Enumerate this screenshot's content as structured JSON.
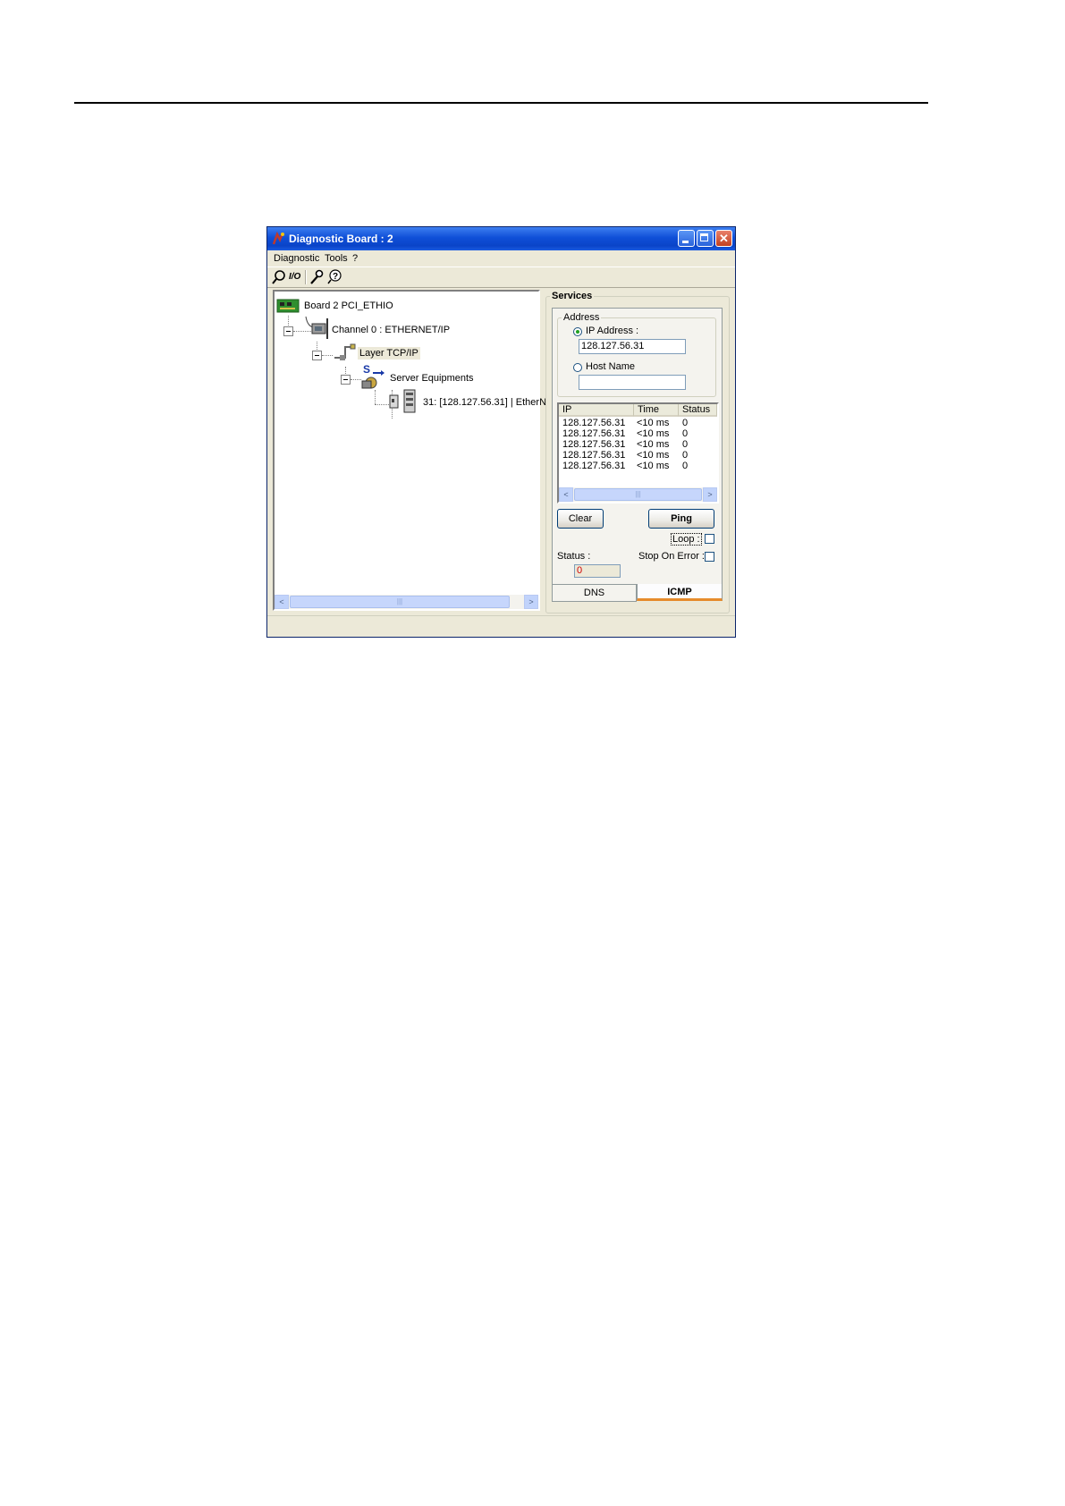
{
  "window": {
    "title": "Diagnostic Board : 2",
    "title_bar_color": "#0a44c8"
  },
  "menu": [
    "Diagnostic",
    "Tools",
    "?"
  ],
  "toolbar": {
    "io_label": "I/O",
    "icons": [
      "search-icon",
      "io-icon",
      "wrench-icon",
      "help-icon"
    ]
  },
  "tree": {
    "board": "Board 2 PCI_ETHIO",
    "channel": "Channel 0 : ETHERNET/IP",
    "layer": "Layer TCP/IP",
    "server": "Server  Equipments",
    "server_badge": "S",
    "equipment": "31: [128.127.56.31] | EtherN"
  },
  "services": {
    "group_label": "Services",
    "address_label": "Address",
    "ip_radio_label": "IP Address :",
    "ip_value": "128.127.56.31",
    "host_radio_label": "Host Name",
    "host_value": "",
    "ip_selected": true,
    "columns": [
      "IP",
      "Time",
      "Status"
    ],
    "rows": [
      {
        "ip": "128.127.56.31",
        "time": "<10 ms",
        "status": "0"
      },
      {
        "ip": "128.127.56.31",
        "time": "<10 ms",
        "status": "0"
      },
      {
        "ip": "128.127.56.31",
        "time": "<10 ms",
        "status": "0"
      },
      {
        "ip": "128.127.56.31",
        "time": "<10 ms",
        "status": "0"
      },
      {
        "ip": "128.127.56.31",
        "time": "<10 ms",
        "status": "0"
      }
    ],
    "clear_label": "Clear",
    "ping_label": "Ping",
    "loop_label": "Loop :",
    "loop_checked": false,
    "status_label": "Status :",
    "status_value": "0",
    "stop_on_error_label": "Stop On Error :",
    "stop_on_error_checked": false,
    "tabs": [
      "DNS",
      "ICMP"
    ],
    "active_tab": "ICMP"
  },
  "scroll_glyphs": {
    "left": "<",
    "right": ">",
    "grip": "|||"
  }
}
